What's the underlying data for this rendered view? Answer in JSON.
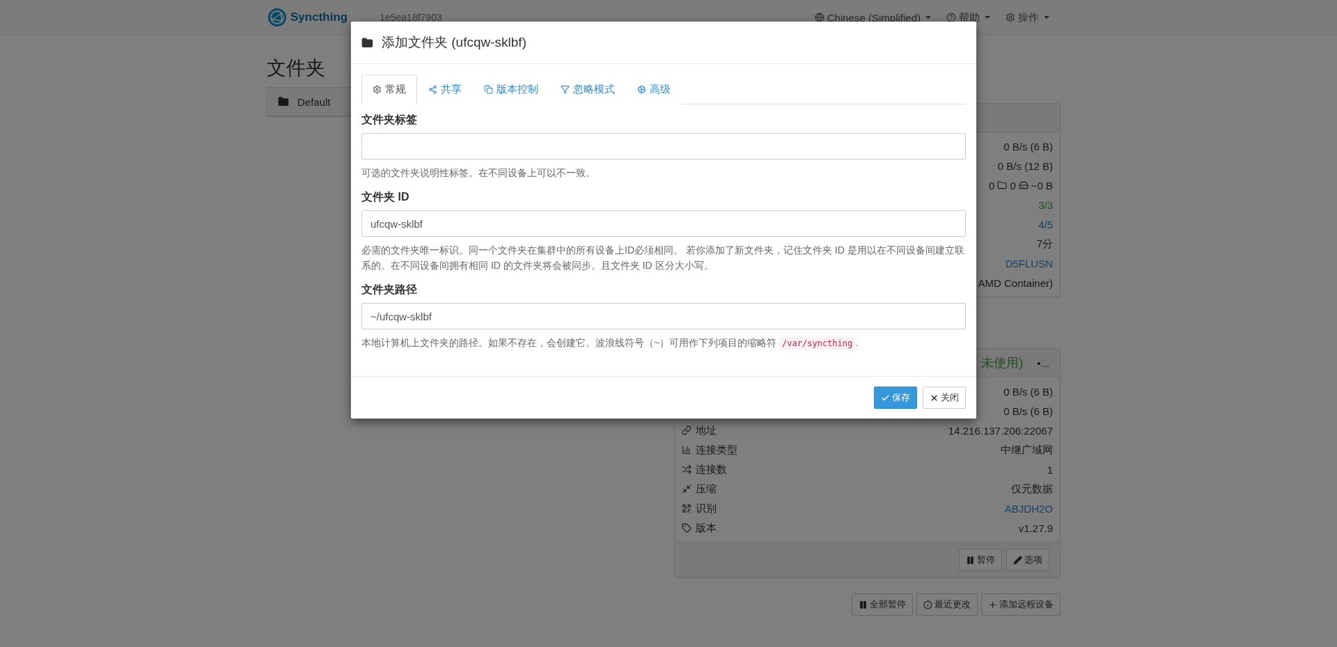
{
  "navbar": {
    "brand": "Syncthing",
    "device_name": "1e5ea18f7903",
    "menus": [
      {
        "label": "Chinese (Simplified)"
      },
      {
        "label": "帮助"
      },
      {
        "label": "操作"
      }
    ]
  },
  "folders": {
    "heading": "文件夹",
    "items": [
      {
        "name": "Default"
      }
    ]
  },
  "this_device": {
    "rows": [
      {
        "kind": "text",
        "value": "0 B/s (6 B)"
      },
      {
        "kind": "text",
        "value": "0 B/s (12 B)"
      },
      {
        "kind": "counts",
        "values": [
          "0",
          "0",
          "~0 B"
        ]
      },
      {
        "kind": "success",
        "value": "3/3"
      },
      {
        "kind": "link",
        "value": "4/5"
      },
      {
        "kind": "text",
        "value": "7分"
      },
      {
        "kind": "link",
        "value": "D5FLUSN"
      },
      {
        "kind": "text",
        "value": "AMD Container)"
      }
    ]
  },
  "remote_device": {
    "status": "未使用)",
    "name": "•...",
    "rows": [
      {
        "value": "0 B/s (6 B)"
      },
      {
        "value": "0 B/s (6 B)"
      },
      {
        "label": "地址",
        "value": "14.216.137.206:22067",
        "kind": "text"
      },
      {
        "label": "连接类型",
        "value": "中继广域网",
        "kind": "text"
      },
      {
        "label": "连接数",
        "value": "1",
        "kind": "text"
      },
      {
        "label": "压缩",
        "value": "仅元数据",
        "kind": "text"
      },
      {
        "label": "识别",
        "value": "ABJDH2O",
        "kind": "link"
      },
      {
        "label": "版本",
        "value": "v1.27.9",
        "kind": "text"
      }
    ],
    "buttons": [
      "暂停",
      "选项"
    ]
  },
  "bottom_buttons": [
    "全部暂停",
    "最近更改",
    "添加远程设备"
  ],
  "modal": {
    "title": "添加文件夹 (ufcqw-sklbf)",
    "tabs": [
      {
        "label": "常规",
        "selected": true
      },
      {
        "label": "共享",
        "selected": false
      },
      {
        "label": "版本控制",
        "selected": false
      },
      {
        "label": "忽略模式",
        "selected": false
      },
      {
        "label": "高级",
        "selected": false
      }
    ],
    "fields": [
      {
        "label": "文件夹标签",
        "help": "可选的文件夹说明性标签。在不同设备上可以不一致。"
      },
      {
        "label": "文件夹 ID",
        "value": "ufcqw-sklbf",
        "help": "必需的文件夹唯一标识。同一个文件夹在集群中的所有设备上ID必须相同。 若你添加了新文件夹，记住文件夹 ID 是用以在不同设备间建立联系的。在不同设备间拥有相同 ID 的文件夹将会被同步。且文件夹 ID 区分大小写。"
      },
      {
        "label": "文件夹路径",
        "value": "~/ufcqw-sklbf",
        "help": "本地计算机上文件夹的路径。如果不存在，会创建它。波浪线符号（~）可用作下列项目的缩略符",
        "help_code": "/var/syncthing",
        "help_end": "."
      }
    ],
    "buttons": [
      {
        "kind": "primary",
        "label": "保存"
      },
      {
        "kind": "default",
        "label": "关闭"
      }
    ]
  }
}
